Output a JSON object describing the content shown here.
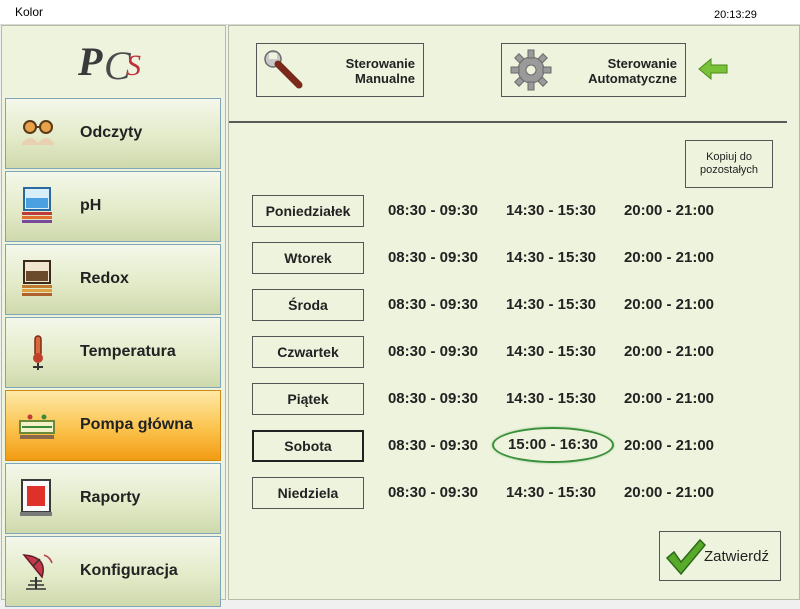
{
  "window": {
    "title": "Kolor",
    "clock": "20:13:29"
  },
  "logo": {
    "text": "PCS"
  },
  "nav": {
    "items": [
      {
        "label": "Odczyty",
        "icon": "readings-icon"
      },
      {
        "label": "pH",
        "icon": "ph-tank-icon"
      },
      {
        "label": "Redox",
        "icon": "redox-tank-icon"
      },
      {
        "label": "Temperatura",
        "icon": "thermometer-icon"
      },
      {
        "label": "Pompa główna",
        "icon": "pump-icon",
        "active": true
      },
      {
        "label": "Raporty",
        "icon": "report-icon"
      },
      {
        "label": "Konfiguracja",
        "icon": "satellite-icon"
      }
    ]
  },
  "modes": {
    "manual_label_1": "Sterowanie",
    "manual_label_2": "Manualne",
    "auto_label_1": "Sterowanie",
    "auto_label_2": "Automatyczne"
  },
  "copy_button": {
    "line1": "Kopiuj do",
    "line2": "pozostałych"
  },
  "schedule": [
    {
      "day": "Poniedziałek",
      "slots": [
        "08:30 - 09:30",
        "14:30 - 15:30",
        "20:00 - 21:00"
      ]
    },
    {
      "day": "Wtorek",
      "slots": [
        "08:30 - 09:30",
        "14:30 - 15:30",
        "20:00 - 21:00"
      ]
    },
    {
      "day": "Środa",
      "slots": [
        "08:30 - 09:30",
        "14:30 - 15:30",
        "20:00 - 21:00"
      ]
    },
    {
      "day": "Czwartek",
      "slots": [
        "08:30 - 09:30",
        "14:30 - 15:30",
        "20:00 - 21:00"
      ]
    },
    {
      "day": "Piątek",
      "slots": [
        "08:30 - 09:30",
        "14:30 - 15:30",
        "20:00 - 21:00"
      ]
    },
    {
      "day": "Sobota",
      "slots": [
        "08:30 - 09:30",
        "15:00 - 16:30",
        "20:00 - 21:00"
      ],
      "selected": true,
      "highlight_slot": 1
    },
    {
      "day": "Niedziela",
      "slots": [
        "08:30 - 09:30",
        "14:30 - 15:30",
        "20:00 - 21:00"
      ]
    }
  ],
  "confirm": {
    "label": "Zatwierdź"
  },
  "colors": {
    "panel_bg": "#eef3dd",
    "active_nav": "#f29b13",
    "accent_green": "#3a8f3a"
  }
}
